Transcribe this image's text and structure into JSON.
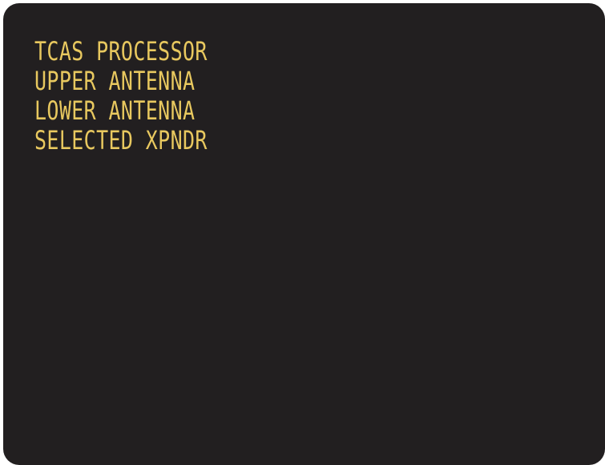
{
  "display": {
    "colors": {
      "background": "#221f20",
      "text": "#e8c85f"
    },
    "messages": [
      "TCAS PROCESSOR",
      "UPPER ANTENNA",
      "LOWER ANTENNA",
      "SELECTED XPNDR"
    ]
  }
}
